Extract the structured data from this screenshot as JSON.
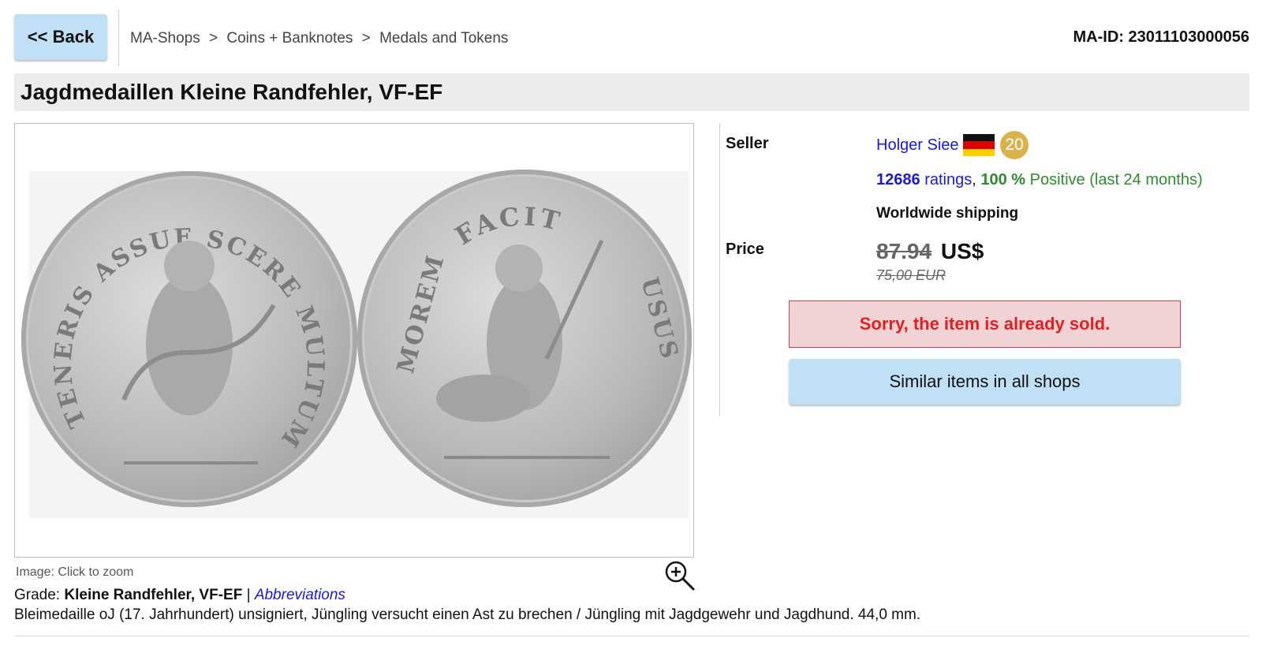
{
  "nav": {
    "back_label": "<< Back",
    "breadcrumb": [
      "MA-Shops",
      "Coins + Banknotes",
      "Medals and Tokens"
    ],
    "breadcrumb_separator": ">",
    "ma_id": "MA-ID: 23011103000056"
  },
  "item": {
    "title": "Jagdmedaillen Kleine Randfehler, VF-EF",
    "image_caption": "Image: Click to zoom",
    "coin_left_legend": "TENERIS ASSUE SCERE MULTUM",
    "coin_right_legend_top": "FACIT",
    "coin_right_legend_left": "MOREM",
    "coin_right_legend_right": "USUS",
    "grade_label": "Grade:",
    "grade_value": "Kleine Randfehler, VF-EF",
    "grade_separator": "|",
    "abbreviations_link": "Abbreviations",
    "description": "Bleimedaille oJ (17. Jahrhundert) unsigniert, Jüngling versucht einen Ast zu brechen / Jüngling mit Jagdgewehr und Jagdhund. 44,0 mm."
  },
  "seller": {
    "label": "Seller",
    "name": "Holger Siee",
    "country_flag": "germany-flag",
    "level": "20",
    "ratings_count": "12686",
    "ratings_word": "ratings",
    "positive_percent": "100 %",
    "positive_text": "Positive (last 24 months)",
    "shipping": "Worldwide shipping"
  },
  "price": {
    "label": "Price",
    "old_usd": "87.94",
    "currency": "US$",
    "eur": "75,00 EUR"
  },
  "status": {
    "sold_message": "Sorry, the item is already sold.",
    "similar_button": "Similar items in all shops"
  },
  "colors": {
    "button_blue": "#bfe0f5",
    "link_blue": "#1a1ad4",
    "positive_green": "#2e8b2e",
    "sold_red": "#e02020",
    "sold_bg": "#f2d3d5",
    "badge_gold": "#d9b24c"
  },
  "icons": [
    "zoom-in-icon",
    "germany-flag"
  ]
}
